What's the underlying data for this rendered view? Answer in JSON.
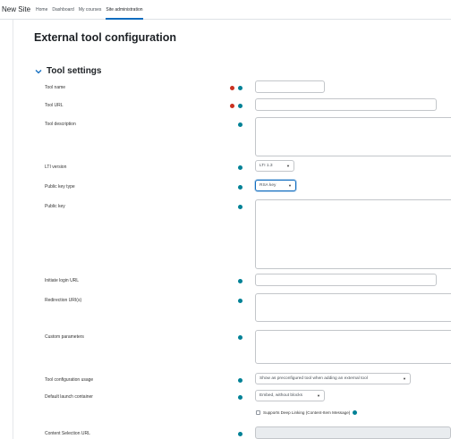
{
  "navbar": {
    "site_name": "New Site",
    "items": [
      {
        "label": "Home",
        "active": false
      },
      {
        "label": "Dashboard",
        "active": false
      },
      {
        "label": "My courses",
        "active": false
      },
      {
        "label": "Site administration",
        "active": true
      }
    ]
  },
  "page": {
    "title": "External tool configuration"
  },
  "section": {
    "title": "Tool settings",
    "collapsed": false
  },
  "fields": {
    "tool_name": {
      "label": "Tool name",
      "value": "",
      "required": true
    },
    "tool_url": {
      "label": "Tool URL",
      "value": "",
      "required": true
    },
    "tool_description": {
      "label": "Tool description",
      "value": ""
    },
    "lti_version": {
      "label": "LTI version",
      "value": "LTI 1.3"
    },
    "public_key_type": {
      "label": "Public key type",
      "value": "RSA key"
    },
    "public_key": {
      "label": "Public key",
      "value": ""
    },
    "initiate_login_url": {
      "label": "Initiate login URL",
      "value": ""
    },
    "redirection_uris": {
      "label": "Redirection URI(s)",
      "value": ""
    },
    "custom_parameters": {
      "label": "Custom parameters",
      "value": ""
    },
    "tool_configuration_usage": {
      "label": "Tool configuration usage",
      "value": "Show as preconfigured tool when adding an external tool"
    },
    "default_launch_container": {
      "label": "Default launch container",
      "value": "Embed, without blocks"
    },
    "supports_deep_linking": {
      "label": "Supports Deep Linking (Content-Item Message)",
      "checked": false
    },
    "content_selection_url": {
      "label": "Content Selection URL",
      "value": ""
    }
  },
  "colors": {
    "required": "#ca3120",
    "help": "#008196",
    "focus": "#0f6cbf"
  }
}
